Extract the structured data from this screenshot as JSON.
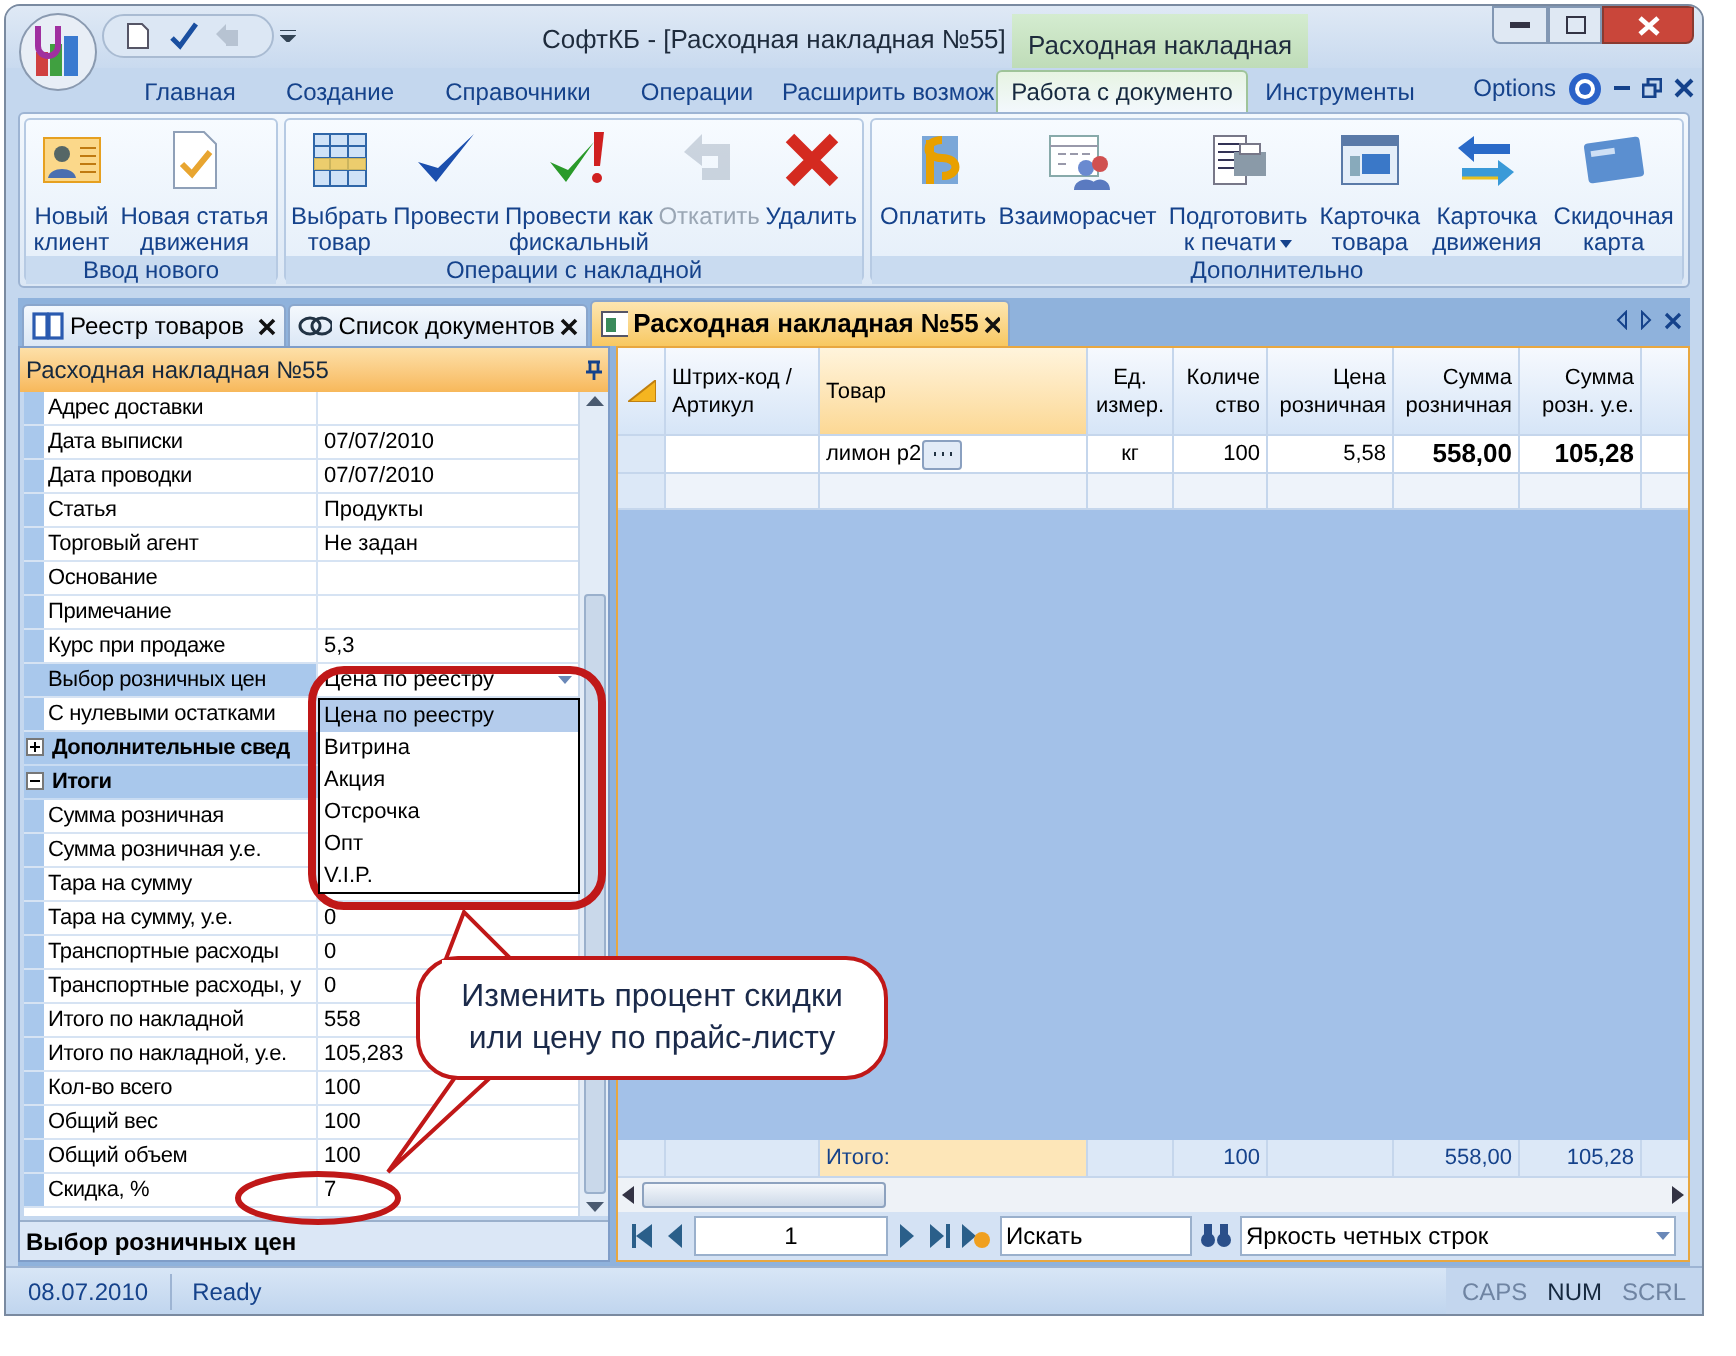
{
  "window": {
    "title": "СофтКБ - [Расходная накладная №55]",
    "context_title": "Расходная накладная"
  },
  "ribbon": {
    "tabs": [
      {
        "label": "Главная",
        "selected": false
      },
      {
        "label": "Создание",
        "selected": false
      },
      {
        "label": "Справочники",
        "selected": false
      },
      {
        "label": "Операции",
        "selected": false
      },
      {
        "label": "Расширить возмож",
        "selected": false
      },
      {
        "label": "Работа с документо",
        "selected": true
      },
      {
        "label": "Инструменты",
        "selected": false
      }
    ],
    "options": "Options",
    "groups": [
      {
        "label": "Ввод нового",
        "buttons": [
          {
            "label": "Новый\nклиент",
            "disabled": false
          },
          {
            "label": "Новая статья\nдвижения",
            "disabled": false
          }
        ]
      },
      {
        "label": "Операции с накладной",
        "buttons": [
          {
            "label": "Выбрать\nтовар",
            "disabled": false
          },
          {
            "label": "Провести",
            "disabled": false
          },
          {
            "label": "Провести как\nфискальный",
            "disabled": false
          },
          {
            "label": "Откатить",
            "disabled": true
          },
          {
            "label": "Удалить",
            "disabled": false
          }
        ]
      },
      {
        "label": "Дополнительно",
        "buttons": [
          {
            "label": "Оплатить",
            "disabled": false
          },
          {
            "label": "Взаиморасчет",
            "disabled": false
          },
          {
            "label": "Подготовить\nк печати",
            "disabled": false,
            "dropdown": true
          },
          {
            "label": "Карточка\nтовара",
            "disabled": false
          },
          {
            "label": "Карточка\nдвижения",
            "disabled": false
          },
          {
            "label": "Скидочная\nкарта",
            "disabled": false
          }
        ]
      }
    ]
  },
  "doc_tabs": [
    {
      "label": "Реестр товаров",
      "selected": false
    },
    {
      "label": "Список документов",
      "selected": false
    },
    {
      "label": "Расходная накладная №55",
      "selected": true
    }
  ],
  "properties": {
    "title": "Расходная накладная №55",
    "rows": [
      {
        "kind": "row",
        "label": "Адрес доставки",
        "value": ""
      },
      {
        "kind": "row",
        "label": "Дата выписки",
        "value": "07/07/2010"
      },
      {
        "kind": "row",
        "label": "Дата проводки",
        "value": "07/07/2010"
      },
      {
        "kind": "row",
        "label": "Статья",
        "value": "Продукты"
      },
      {
        "kind": "row",
        "label": "Торговый агент",
        "value": "Не задан"
      },
      {
        "kind": "row",
        "label": "Основание",
        "value": ""
      },
      {
        "kind": "row",
        "label": "Примечание",
        "value": ""
      },
      {
        "kind": "row",
        "label": "Курс при продаже",
        "value": "5,3"
      },
      {
        "kind": "combo",
        "label": "Выбор розничных цен",
        "value": "Цена по реестру",
        "selected": true
      },
      {
        "kind": "row",
        "label": "С нулевыми остатками",
        "value": ""
      },
      {
        "kind": "category",
        "label": "Дополнительные свед",
        "expanded": false
      },
      {
        "kind": "category",
        "label": "Итоги",
        "expanded": true
      },
      {
        "kind": "row",
        "label": "Сумма розничная",
        "value": ""
      },
      {
        "kind": "row",
        "label": "Сумма розничная у.е.",
        "value": ""
      },
      {
        "kind": "row",
        "label": "Тара на сумму",
        "value": ""
      },
      {
        "kind": "row",
        "label": "Тара на сумму, у.е.",
        "value": "0"
      },
      {
        "kind": "row",
        "label": "Транспортные расходы",
        "value": "0"
      },
      {
        "kind": "row",
        "label": "Транспортные расходы, у",
        "value": "0"
      },
      {
        "kind": "row",
        "label": "Итого по накладной",
        "value": "558"
      },
      {
        "kind": "row",
        "label": "Итого по накладной, у.е.",
        "value": "105,283"
      },
      {
        "kind": "row",
        "label": "Кол-во всего",
        "value": "100"
      },
      {
        "kind": "row",
        "label": "Общий вес",
        "value": "100"
      },
      {
        "kind": "row",
        "label": "Общий объем",
        "value": "100"
      },
      {
        "kind": "row",
        "label": "Скидка, %",
        "value": "7"
      }
    ],
    "dropdown_options": [
      {
        "label": "Цена по реестру",
        "selected": true
      },
      {
        "label": "Витрина",
        "selected": false
      },
      {
        "label": "Акция",
        "selected": false
      },
      {
        "label": "Отсрочка",
        "selected": false
      },
      {
        "label": "Опт",
        "selected": false
      },
      {
        "label": "V.I.P.",
        "selected": false
      }
    ],
    "description": "Выбор розничных цен"
  },
  "grid": {
    "columns": [
      {
        "label": "Штрих-код /\nАртикул",
        "selected": false,
        "bold": false
      },
      {
        "label": "Товар",
        "selected": true,
        "bold": false
      },
      {
        "label": "Ед.\nизмер.",
        "selected": false,
        "bold": false
      },
      {
        "label": "Количе\nство",
        "selected": false,
        "bold": false
      },
      {
        "label": "Цена\nрозничная",
        "selected": false,
        "bold": false
      },
      {
        "label": "Сумма\nрозничная",
        "selected": false,
        "bold": true
      },
      {
        "label": "Сумма\nрозн. у.е.",
        "selected": false,
        "bold": true
      }
    ],
    "rows": [
      {
        "cells": [
          "",
          "лимон р2",
          "кг",
          "100",
          "5,58",
          "558,00",
          "105,28"
        ]
      }
    ],
    "totals": {
      "item": "Итого:",
      "quantity": "100",
      "sum": "558,00",
      "sum_ue": "105,28"
    },
    "navigator": {
      "page": "1",
      "search": "Искать",
      "view": "Яркость четных строк"
    }
  },
  "callout": "Изменить процент скидки\nили цену по прайс-листу",
  "status_bar": {
    "date": "08.07.2010",
    "status": "Ready",
    "indicators": [
      {
        "label": "CAPS",
        "on": false
      },
      {
        "label": "NUM",
        "on": true
      },
      {
        "label": "SCRL",
        "on": false
      }
    ]
  }
}
